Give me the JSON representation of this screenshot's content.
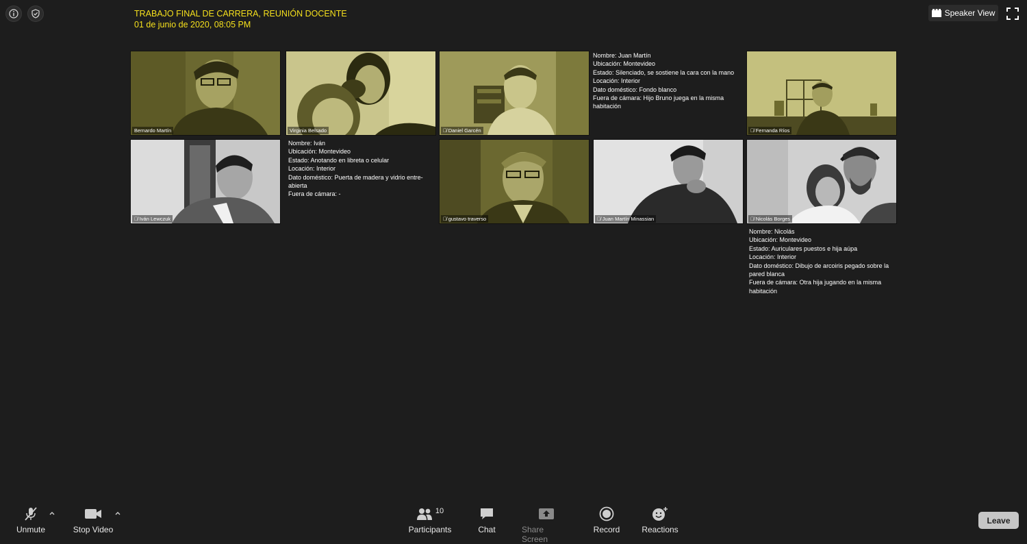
{
  "meeting": {
    "title": "TRABAJO FINAL DE CARRERA, REUNIÓN DOCENTE",
    "datetime": "01 de junio de 2020, 08:05 PM",
    "title_color": "#f5e01d"
  },
  "top_bar": {
    "info_icon": "info-icon",
    "shield_icon": "shield-check-icon",
    "view_label": "Speaker View",
    "fullscreen_icon": "fullscreen-icon"
  },
  "participants": [
    {
      "name": "Bernardo Martín",
      "tint": "yellow",
      "muted": false
    },
    {
      "name": "Virginia Belsado",
      "tint": "yellow",
      "muted": false
    },
    {
      "name": "Daniel Garcén",
      "tint": "yellow",
      "muted": true
    },
    {
      "name": "Fernanda Ríos",
      "tint": "yellow",
      "muted": true
    },
    {
      "name": "Iván Lewczuk",
      "tint": "gray",
      "muted": true
    },
    {
      "name": "gustavo traverso",
      "tint": "yellow",
      "muted": true
    },
    {
      "name": "Juan Martín Minassian",
      "tint": "gray",
      "muted": true
    },
    {
      "name": "Nicolás Borges",
      "tint": "gray",
      "muted": true
    }
  ],
  "annotations": {
    "juan": [
      "Nombre: Juan Martín",
      "Ubicación: Montevideo",
      "Estado: Silenciado, se sostiene la cara con la mano",
      "Locación: Interior",
      "Dato doméstico: Fondo blanco",
      "Fuera de cámara: Hijo Bruno juega en la misma habitación"
    ],
    "ivan": [
      "Nombre: Iván",
      "Ubicación: Montevideo",
      "Estado: Anotando en libreta o celular",
      "Locación: Interior",
      "Dato doméstico: Puerta de madera y vidrio entre-abierta",
      "Fuera de cámara: -"
    ],
    "nicolas": [
      "Nombre: Nicolás",
      "Ubicación: Montevideo",
      "Estado: Auriculares puestos e hija aúpa",
      "Locación: Interior",
      "Dato doméstico: Dibujo de arcoiris pegado sobre la pared blanca",
      "Fuera de cámara: Otra hija jugando en la misma habitación"
    ]
  },
  "toolbar": {
    "unmute": "Unmute",
    "stop_video": "Stop Video",
    "participants": "Participants",
    "participants_count": "10",
    "chat": "Chat",
    "share_screen": "Share Screen",
    "record": "Record",
    "reactions": "Reactions",
    "leave": "Leave"
  },
  "colors": {
    "background": "#1d1d1d",
    "yellow_tint": "#8d8a3c",
    "gray_tint": "#8a8a8a",
    "leave_button": "#c6c6c6"
  }
}
